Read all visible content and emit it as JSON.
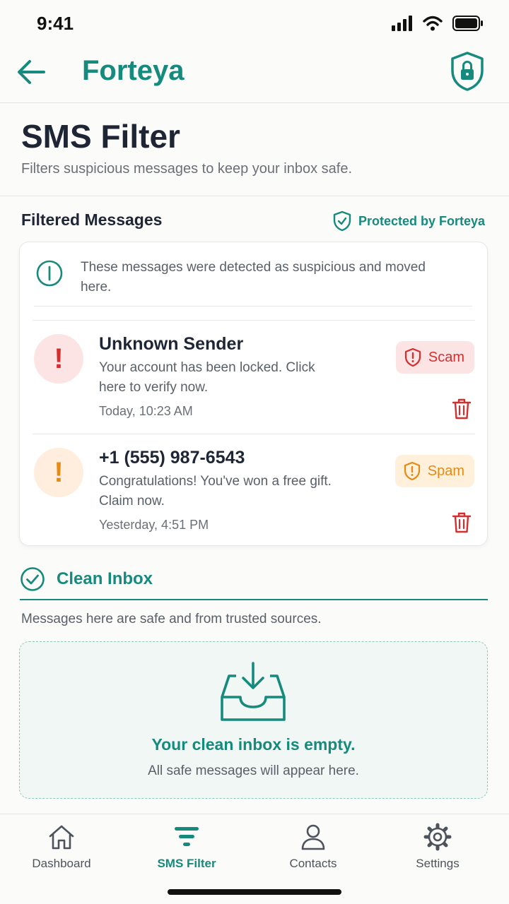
{
  "status_bar": {
    "time": "9:41"
  },
  "app_bar": {
    "title": "Forteya"
  },
  "page": {
    "title": "SMS Filter",
    "subtitle": "Filters suspicious messages to keep your inbox safe."
  },
  "filtered": {
    "title": "Filtered Messages",
    "protected_label": "Protected by Forteya",
    "notice": "These messages were detected as suspicious and moved here.",
    "messages": [
      {
        "sender": "Unknown Sender",
        "body": "Your account has been locked. Click here to verify now.",
        "time": "Today, 10:23 AM",
        "tag": "Scam",
        "avatar_glyph": "!"
      },
      {
        "sender": "+1 (555) 987-6543",
        "body": "Congratulations! You've won a free gift. Claim now.",
        "time": "Yesterday, 4:51 PM",
        "tag": "Spam",
        "avatar_glyph": "!"
      }
    ]
  },
  "clean_inbox": {
    "title": "Clean Inbox",
    "subtitle": "Messages here are safe and from trusted sources.",
    "empty_title": "Your clean inbox is empty.",
    "empty_subtitle": "All safe messages will appear here."
  },
  "bottom_nav": {
    "items": [
      {
        "label": "Dashboard",
        "icon": "home-icon"
      },
      {
        "label": "SMS Filter",
        "icon": "filter-icon",
        "active": true
      },
      {
        "label": "Contacts",
        "icon": "person-icon"
      },
      {
        "label": "Settings",
        "icon": "gear-icon"
      }
    ]
  },
  "colors": {
    "brand": "#168a7c",
    "scam": "#d32f2f",
    "scam_bg": "#fde4e4",
    "spam": "#e58a12",
    "spam_bg": "#fff0dc"
  }
}
